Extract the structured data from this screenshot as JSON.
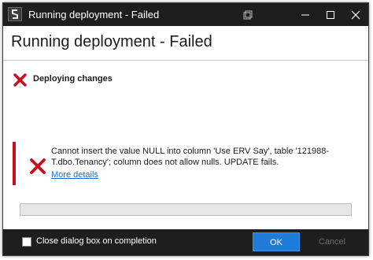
{
  "window": {
    "title": "Running deployment - Failed",
    "app_icon": "ssms-app-icon",
    "controls": [
      "minimize-icon",
      "maximize-icon",
      "close-icon"
    ]
  },
  "header": {
    "title": "Running deployment - Failed"
  },
  "step": {
    "icon": "error-x-icon",
    "label": "Deploying changes"
  },
  "error": {
    "icon": "error-x-icon",
    "message": "Cannot insert the value NULL into column 'Use ERV Say', table '121988-T.dbo.Tenancy'; column does not allow nulls. UPDATE fails.",
    "link": "More details"
  },
  "progress": {
    "value": 0
  },
  "footer": {
    "checkbox_label": "Close dialog box on completion",
    "checkbox_checked": false,
    "ok_label": "OK",
    "cancel_label": "Cancel"
  },
  "colors": {
    "titlebar": "#1e1e1e",
    "error_red": "#c50f1f",
    "ok_blue": "#1e7bd8",
    "link_blue": "#1a6fc9"
  }
}
